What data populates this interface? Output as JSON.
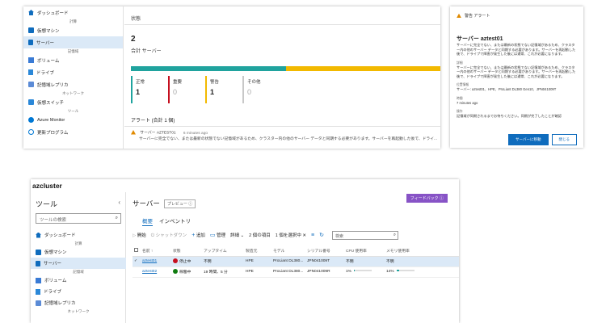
{
  "colors": {
    "accent": "#0f6cbd",
    "healthy": "#20a39e",
    "warning": "#f2b900",
    "stopped": "#c50f1f",
    "running": "#107c10",
    "feedback": "#8753c6"
  },
  "top_nav": {
    "items": [
      {
        "type": "item",
        "label": "ダッシュボード",
        "icon": "home-icon"
      },
      {
        "type": "section",
        "label": "計算"
      },
      {
        "type": "item",
        "label": "仮想マシン",
        "icon": "vm-icon"
      },
      {
        "type": "item",
        "label": "サーバー",
        "icon": "server-icon",
        "selected": true
      },
      {
        "type": "section",
        "label": "記憶域"
      },
      {
        "type": "item",
        "label": "ボリューム",
        "icon": "volume-icon"
      },
      {
        "type": "item",
        "label": "ドライブ",
        "icon": "drive-icon"
      },
      {
        "type": "item",
        "label": "記憶域レプリカ",
        "icon": "replica-icon"
      },
      {
        "type": "section",
        "label": "ネットワーク"
      },
      {
        "type": "item",
        "label": "仮想スイッチ",
        "icon": "switch-icon"
      },
      {
        "type": "section",
        "label": "ツール"
      },
      {
        "type": "item",
        "label": "Azure Monitor",
        "icon": "monitor-icon"
      },
      {
        "type": "item",
        "label": "更新プログラム",
        "icon": "update-icon"
      }
    ]
  },
  "status": {
    "header": "状態",
    "total": "2",
    "total_label": "合計 サーバー",
    "cards": [
      {
        "label": "正常",
        "value": "1",
        "color": "#20a39e",
        "dim": false
      },
      {
        "label": "重要",
        "value": "0",
        "color": "#c50f1f",
        "dim": true
      },
      {
        "label": "警告",
        "value": "1",
        "color": "#f2b900",
        "dim": false
      },
      {
        "label": "その他",
        "value": "0",
        "color": "#c8c8c8",
        "dim": true
      }
    ],
    "alerts_header": "アラート (合計 1 個)",
    "alert": {
      "title": "サーバー AZTEST01",
      "time": "6 minutes ago",
      "desc": "サーバーに完全でない、または最新の状態でない記憶域があるため、クラスター内の他のサーバー データと同期する必要があります。サーバーを再起動した後で、ドライ..."
    }
  },
  "alert_panel": {
    "title": "警告 アラート",
    "server": "サーバー aztest01",
    "desc": "サーバーに完全でない、または最新の状態でない記憶域があるため、クラスター内の他のサーバー データと同期する必要があります。サーバーを再起動した後で、ドライブで障害が発生した後には通常、これが必要になります。",
    "detail_label": "詳細",
    "detail": "サーバーに完全でない、または最新の状態でない記憶域があるため、クラスター内の他のサーバー データと同期する必要があります。サーバーを再起動した後で、ドライブで障害が発生した後には通常、これが必要になります。",
    "location_label": "位置情報",
    "location": "サーバー: aztest01、HPE、ProLiant DL380 Gen10、JPN041009T",
    "time_label": "時間",
    "time": "7 minutes ago",
    "action_label": "操作",
    "action": "記憶域が同期されるまでお待ちください。同期が完了したことが確認",
    "primary_button": "サーバーに移動",
    "close_button": "閉じる"
  },
  "bottom": {
    "app_name": "azcluster",
    "tools_title": "ツール",
    "tools_search_placeholder": "ツールの検索",
    "nav": [
      {
        "type": "item",
        "label": "ダッシュボード",
        "icon": "home-icon"
      },
      {
        "type": "section",
        "label": "計算"
      },
      {
        "type": "item",
        "label": "仮想マシン",
        "icon": "vm-icon"
      },
      {
        "type": "item",
        "label": "サーバー",
        "icon": "server-icon",
        "selected": true
      },
      {
        "type": "section",
        "label": "記憶域"
      },
      {
        "type": "item",
        "label": "ボリューム",
        "icon": "volume-icon"
      },
      {
        "type": "item",
        "label": "ドライブ",
        "icon": "drive-icon"
      },
      {
        "type": "item",
        "label": "記憶域レプリカ",
        "icon": "replica-icon"
      },
      {
        "type": "section",
        "label": "ネットワーク"
      }
    ],
    "page_title": "サーバー",
    "preview_badge": "プレビュー ⓘ",
    "feedback": "フィードバック ⓘ",
    "tabs": [
      {
        "label": "概要",
        "selected": true
      },
      {
        "label": "インベントリ",
        "selected": false
      }
    ],
    "toolbar": {
      "start": "開始",
      "shutdown": "シャットダウン",
      "add": "追加",
      "manage": "管理",
      "more": "詳細",
      "items_count": "2 個の項目",
      "selected": "1 個を選択中",
      "search_placeholder": "検索"
    },
    "table": {
      "headers": [
        "名前 ↑",
        "状態",
        "アップタイム",
        "製造元",
        "モデル",
        "シリアル番号",
        "CPU 使用率",
        "メモリ使用率"
      ],
      "rows": [
        {
          "name": "aztest01",
          "status": "停止中",
          "status_kind": "stopped",
          "uptime": "不明",
          "maker": "HPE",
          "model": "ProLiant DL380...",
          "serial": "JPN041009T",
          "cpu": "不明",
          "mem": "不明",
          "selected": true
        },
        {
          "name": "aztest02",
          "status": "稼働中",
          "status_kind": "running",
          "uptime": "19 時間、5 分",
          "maker": "HPE",
          "model": "ProLiant DL380...",
          "serial": "JPN041009R",
          "cpu": "1%",
          "cpu_pct": 1,
          "mem": "14%",
          "mem_pct": 14,
          "selected": false
        }
      ]
    }
  }
}
